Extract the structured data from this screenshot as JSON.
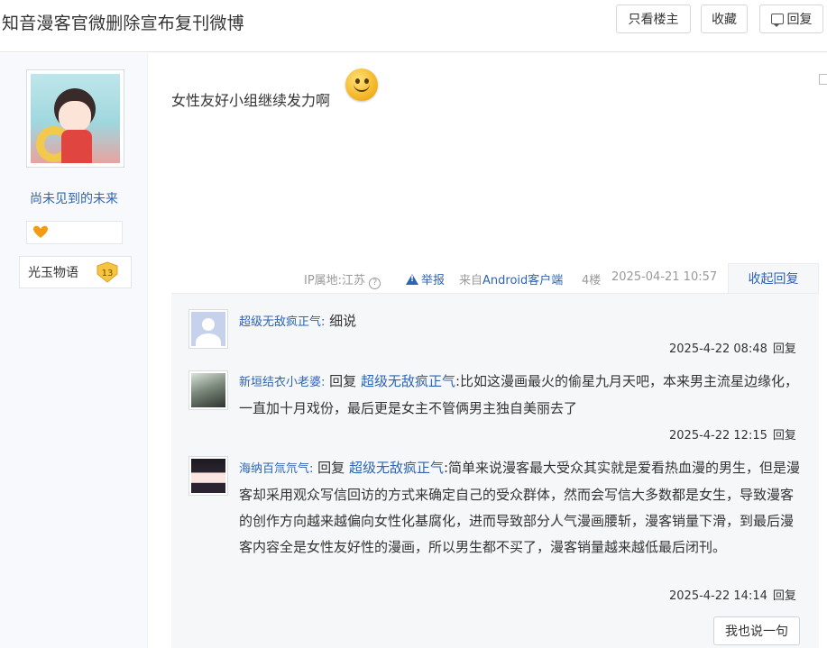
{
  "header": {
    "title": "知音漫客官微删除宣布复刊微博",
    "only_op_label": "只看楼主",
    "favorite_label": "收藏",
    "reply_label": "回复"
  },
  "author": {
    "name": "尚未见到的未来",
    "forum_badge": "光玉物语",
    "forum_level": "13"
  },
  "post": {
    "content": "女性友好小组继续发力啊",
    "emoji": "smiley-face",
    "ip_location": "IP属地:江苏",
    "report_label": "举报",
    "source_prefix": "来自",
    "source_client": "Android客户端",
    "floor": "4楼",
    "time": "2025-04-21 10:57",
    "collapse_label": "收起回复"
  },
  "replies": [
    {
      "user": "超级无敌疯正气:",
      "prefix": "",
      "at_user": "",
      "text": "细说",
      "time": "2025-4-22 08:48",
      "reply_label": "回复"
    },
    {
      "user": "新垣结衣小老婆:",
      "prefix": "回复",
      "at_user": "超级无敌疯正气",
      "text": ":比如这漫画最火的偷星九月天吧，本来男主流星边缘化，一直加十月戏份，最后更是女主不管俩男主独自美丽去了",
      "time": "2025-4-22 12:15",
      "reply_label": "回复"
    },
    {
      "user": "海纳百氚氘气:",
      "prefix": "回复",
      "at_user": "超级无敌疯正气",
      "text": ":简单来说漫客最大受众其实就是爱看热血漫的男生，但是漫客却采用观众写信回访的方式来确定自己的受众群体，然而会写信大多数都是女生，导致漫客的创作方向越来越偏向女性化基腐化，进而导致部分人气漫画腰斩，漫客销量下滑，到最后漫客内容全是女性友好性的漫画，所以男生都不买了，漫客销量越来越低最后闭刊。",
      "time": "2025-4-22 14:14",
      "reply_label": "回复"
    }
  ],
  "say_something_label": "我也说一句",
  "colors": {
    "link": "#2d64b3",
    "sidebar_bg": "#f7f9fc",
    "reply_bg": "#f6f7f9"
  }
}
